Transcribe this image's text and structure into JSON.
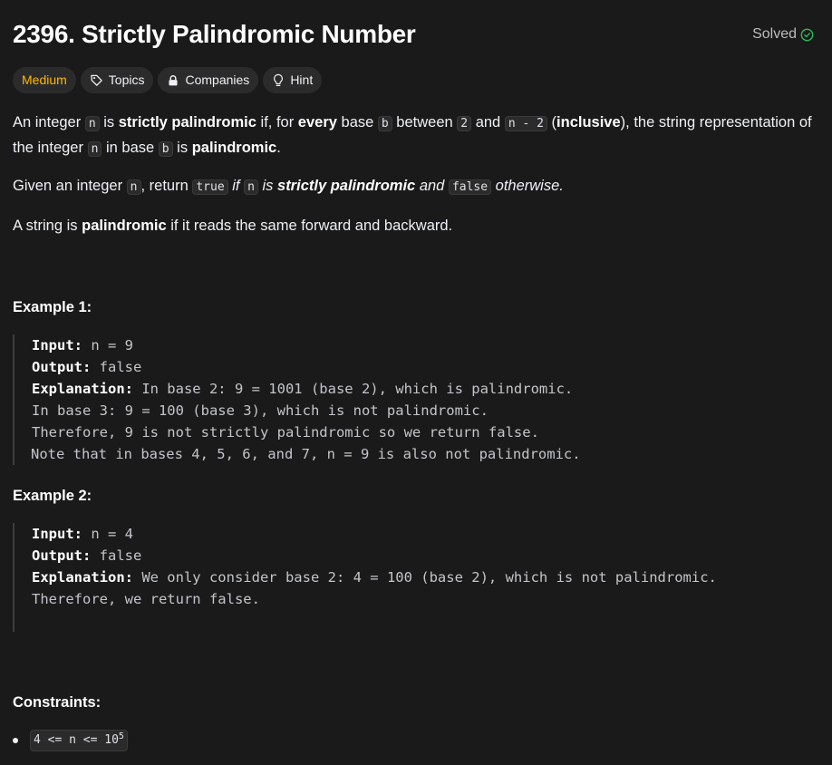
{
  "problem": {
    "title": "2396. Strictly Palindromic Number",
    "status": "Solved",
    "status_color": "#2cbb5d",
    "difficulty_color": "#ffb800"
  },
  "tags": {
    "difficulty": "Medium",
    "topics": "Topics",
    "companies": "Companies",
    "hint": "Hint"
  },
  "description": {
    "p1": {
      "t1": "An integer ",
      "c_n": "n",
      "t2": " is ",
      "b1": "strictly palindromic",
      "t3": " if, for ",
      "b2": "every",
      "t4": " base ",
      "c_b": "b",
      "t5": " between ",
      "c_2": "2",
      "t6": " and ",
      "c_n2": "n - 2",
      "t7": " (",
      "b3": "inclusive",
      "t8": "), the string representation of the integer ",
      "c_n3": "n",
      "t9": " in base ",
      "c_b2": "b",
      "t10": " is ",
      "b4": "palindromic",
      "t11": "."
    },
    "p2": {
      "t1": "Given an integer ",
      "c_n": "n",
      "t2": ", return ",
      "c_true": "true",
      "i1": " if ",
      "c_n2": "n",
      "i2": " is ",
      "bi": "strictly palindromic",
      "i3": " and ",
      "c_false": "false",
      "i4": " otherwise."
    },
    "p3": {
      "t1": "A string is ",
      "b1": "palindromic",
      "t2": " if it reads the same forward and backward."
    }
  },
  "examples": [
    {
      "title": "Example 1:",
      "input_label": "Input:",
      "input": " n = 9",
      "output_label": "Output:",
      "output": " false",
      "explanation_label": "Explanation:",
      "explanation_lines": [
        " In base 2: 9 = 1001 (base 2), which is palindromic.",
        "In base 3: 9 = 100 (base 3), which is not palindromic.",
        "Therefore, 9 is not strictly palindromic so we return false.",
        "Note that in bases 4, 5, 6, and 7, n = 9 is also not palindromic."
      ]
    },
    {
      "title": "Example 2:",
      "input_label": "Input:",
      "input": " n = 4",
      "output_label": "Output:",
      "output": " false",
      "explanation_label": "Explanation:",
      "explanation_lines": [
        " We only consider base 2: 4 = 100 (base 2), which is not palindromic.",
        "Therefore, we return false."
      ]
    }
  ],
  "constraints": {
    "title": "Constraints:",
    "item_base": "4 <= n <= 10",
    "item_exp": "5"
  }
}
